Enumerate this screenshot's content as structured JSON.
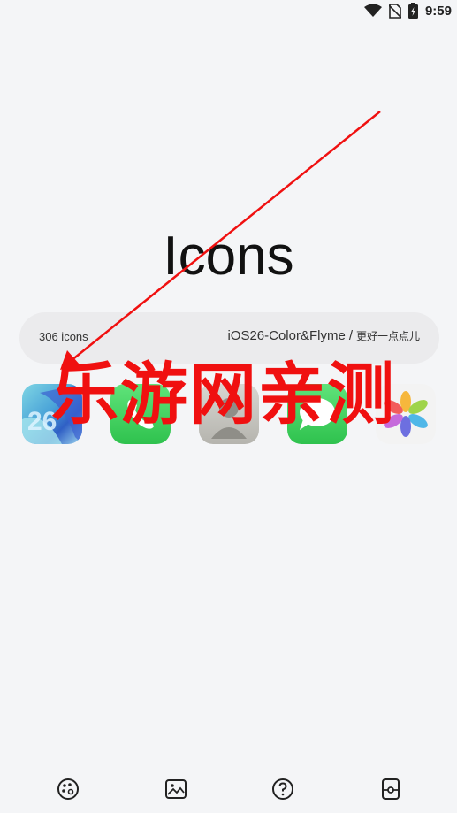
{
  "status_bar": {
    "time": "9:59",
    "icons": [
      "wifi-icon",
      "no-sim-icon",
      "battery-charging-icon"
    ]
  },
  "main": {
    "title": "Icons",
    "icon_count": "306 icons",
    "pack_title": "iOS26-Color&Flyme",
    "pack_separator": "/",
    "pack_author": "更好一点点儿",
    "preview_icons": [
      "wallpaper-icon",
      "phone-app-icon",
      "contacts-app-icon",
      "messages-app-icon",
      "photos-app-icon"
    ]
  },
  "watermark": {
    "text": "乐游网亲测",
    "color": "#f01010"
  },
  "bottom_nav": {
    "items": [
      "palette-icon",
      "image-icon",
      "help-icon",
      "widget-icon"
    ]
  },
  "colors": {
    "background": "#f4f5f7",
    "pill": "#ebebed",
    "accent_green": "#2fc24e"
  }
}
